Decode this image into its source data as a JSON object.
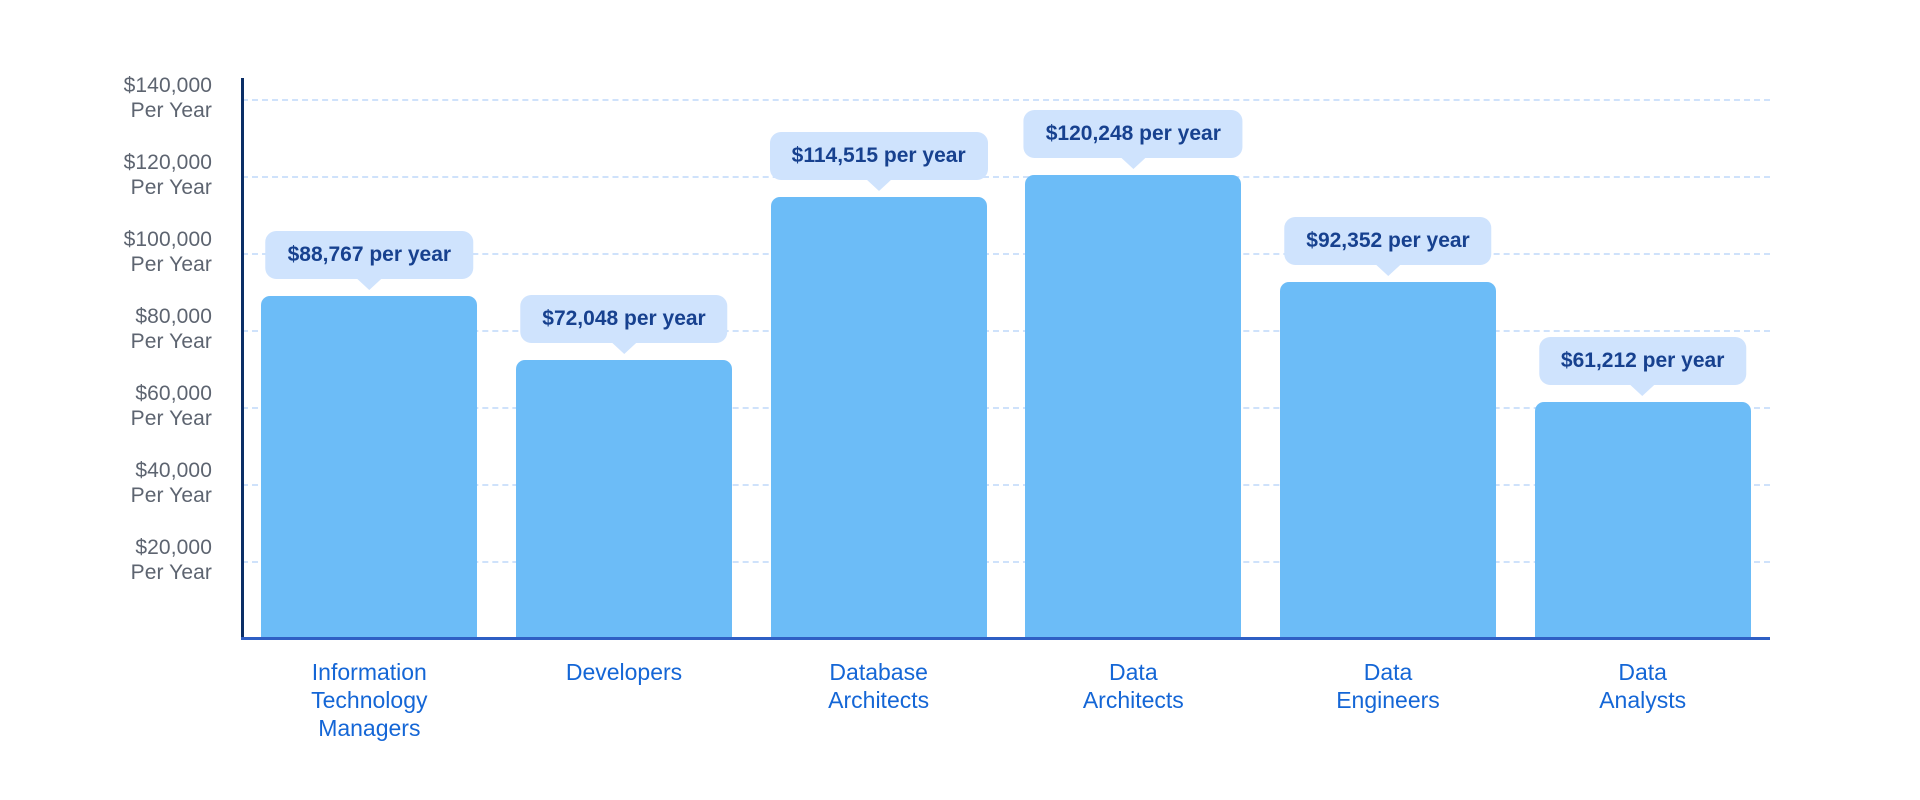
{
  "chart_data": {
    "type": "bar",
    "title": "",
    "subtitle": "",
    "xlabel": "",
    "ylabel": "",
    "categories": [
      "Information\nTechnology\nManagers",
      "Developers",
      "Database\nArchitects",
      "Data\nArchitects",
      "Data\nEngineers",
      "Data\nAnalysts"
    ],
    "values": [
      88767,
      72048,
      114515,
      120248,
      92352,
      61212
    ],
    "value_labels": [
      "$88,767 per year",
      "$72,048 per year",
      "$114,515 per year",
      "$120,248 per year",
      "$92,352 per year",
      "$61,212 per year"
    ],
    "ylim": [
      0,
      150000
    ],
    "yticks": [
      20000,
      40000,
      60000,
      80000,
      100000,
      120000,
      140000
    ],
    "ytick_labels": [
      "$20,000\nPer Year",
      "$40,000\nPer Year",
      "$60,000\nPer Year",
      "$80,000\nPer Year",
      "$100,000\nPer Year",
      "$120,000\nPer Year",
      "$140,000\nPer Year"
    ],
    "grid": true,
    "grid_style": "dashed",
    "legend": false,
    "legend_position": "none",
    "colors": {
      "bar": "#6cbcf7",
      "tooltip_bg": "#cfe3fd",
      "tooltip_text": "#17418f",
      "gridline": "#cfe2fb",
      "y_axis": "#0b2e66",
      "x_axis": "#2f5fc4",
      "y_tick_label": "#5d6470",
      "category_label": "#1466d6",
      "background": "#ffffff"
    }
  }
}
